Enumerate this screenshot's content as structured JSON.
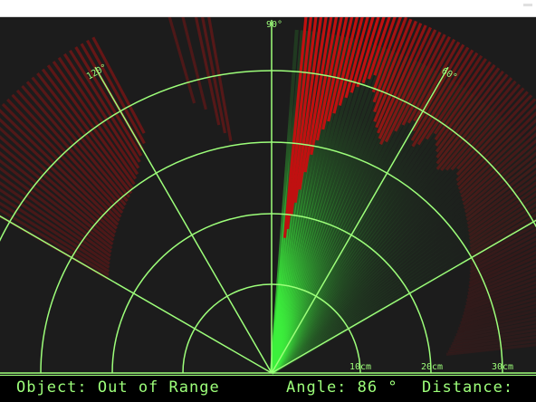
{
  "window": {
    "title": ""
  },
  "radar": {
    "angle_labels": [
      "90°",
      "60°",
      "120°"
    ],
    "range_labels": [
      "10cm",
      "20cm",
      "30cm"
    ],
    "sweep_angle_deg": 86
  },
  "status": {
    "object_text": "Object: Out of Range",
    "angle_text": "Angle: 86 °",
    "distance_text": "Distance:"
  },
  "colors": {
    "background": "#1c1c1c",
    "grid": "#9dff7a",
    "sweep": "#3cf03c",
    "detected": "#c01010",
    "status_text": "#9dff7a"
  }
}
